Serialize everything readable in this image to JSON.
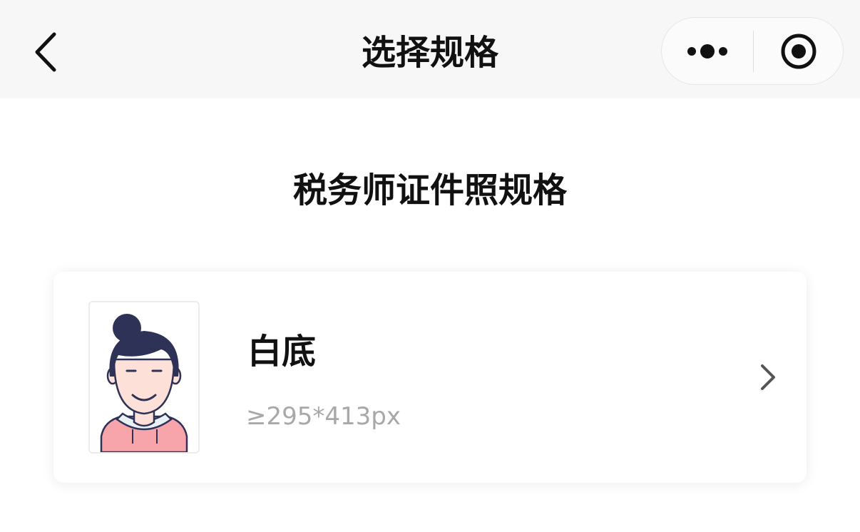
{
  "navbar": {
    "title": "选择规格"
  },
  "page": {
    "section_title": "税务师证件照规格"
  },
  "spec_card": {
    "name": "白底",
    "size": "≥295*413px"
  },
  "icons": {
    "back": "chevron-left-icon",
    "more": "more-dots-icon",
    "close": "target-circle-icon",
    "arrow": "chevron-right-icon"
  },
  "colors": {
    "navbar_bg": "#f7f7f7",
    "title_text": "#111111",
    "secondary_text": "#a8a8a8",
    "hair": "#2f3257",
    "skin": "#fde0d8",
    "shirt": "#f7a5ab"
  }
}
